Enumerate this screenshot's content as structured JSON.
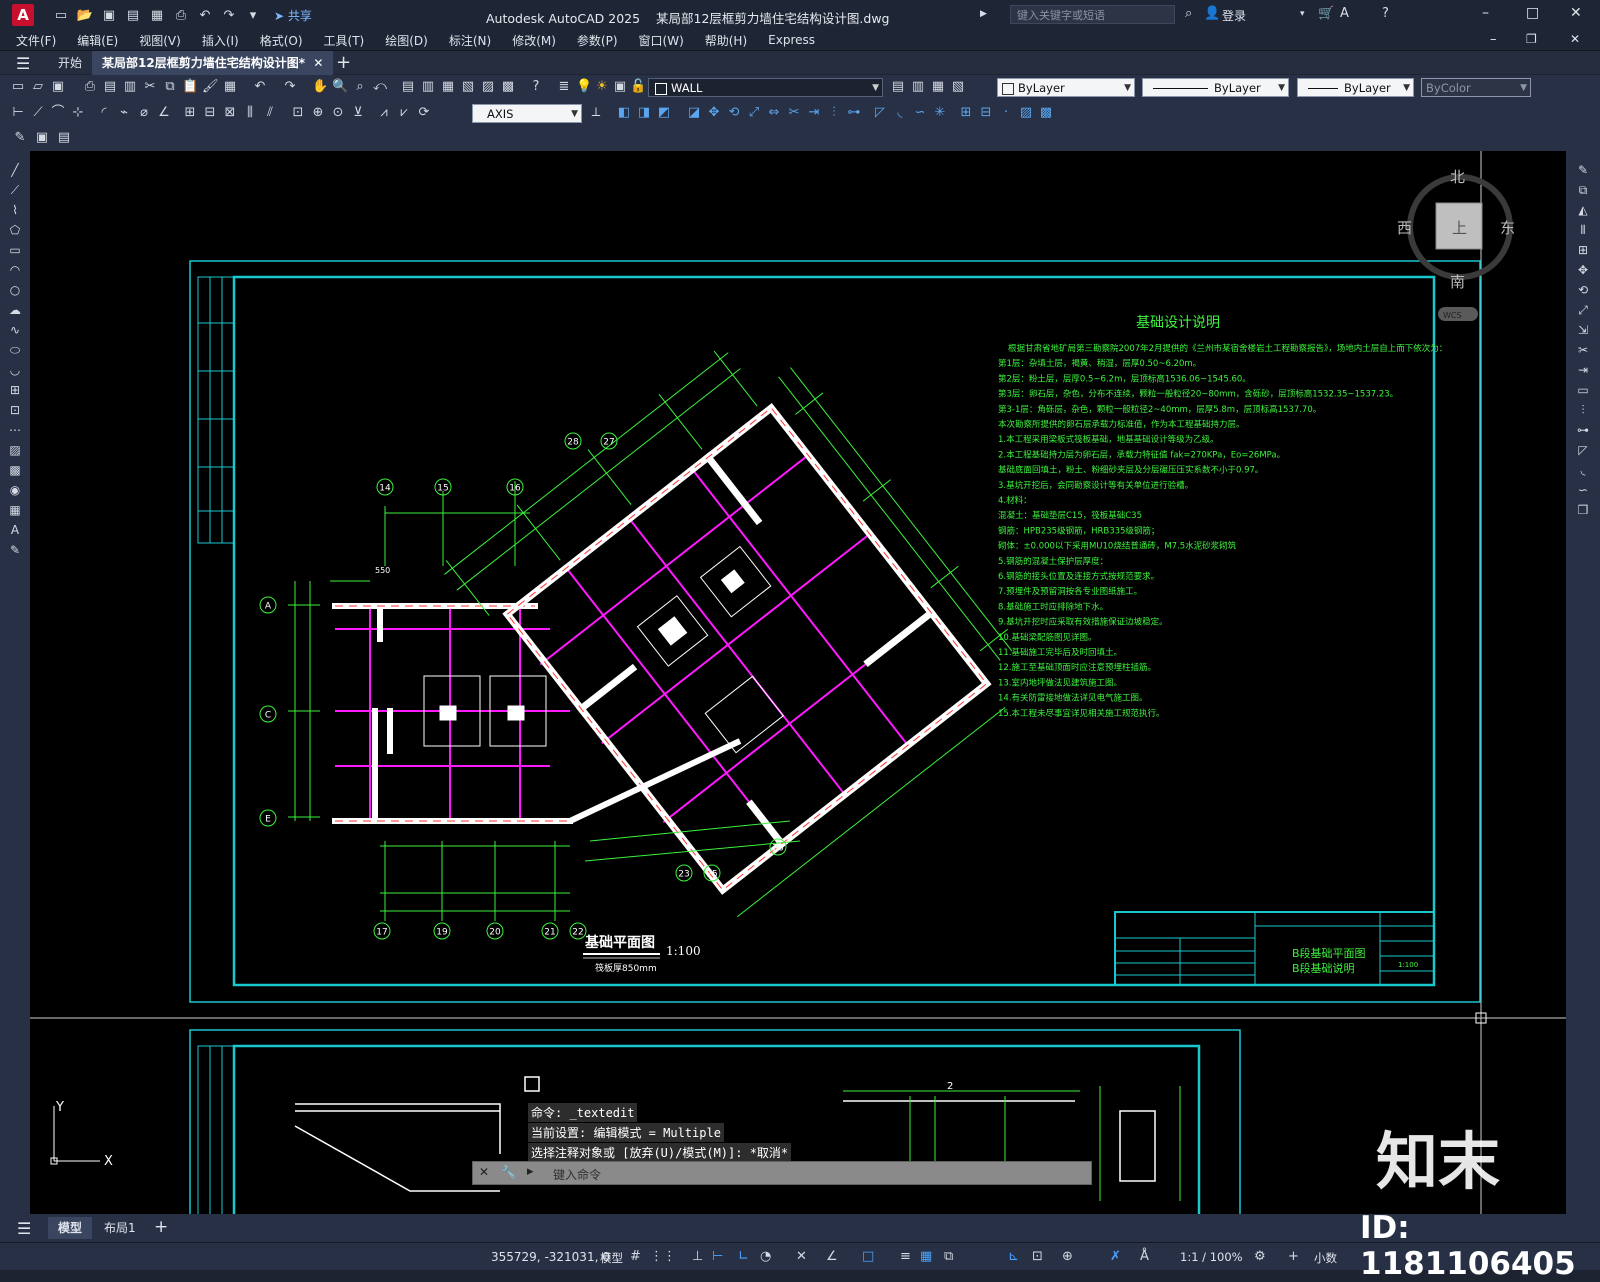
{
  "window": {
    "app_title": "Autodesk AutoCAD 2025",
    "file_name": "某局部12层框剪力墙住宅结构设计图.dwg",
    "share_label": "共享",
    "search_placeholder": "键入关键字或短语",
    "login_label": "登录"
  },
  "menu": [
    "文件(F)",
    "编辑(E)",
    "视图(V)",
    "插入(I)",
    "格式(O)",
    "工具(T)",
    "绘图(D)",
    "标注(N)",
    "修改(M)",
    "参数(P)",
    "窗口(W)",
    "帮助(H)",
    "Express"
  ],
  "tabs": {
    "start": "开始",
    "document": "某局部12层框剪力墙住宅结构设计图*"
  },
  "toolbar": {
    "layer_name": "WALL",
    "color": "ByLayer",
    "linetype": "ByLayer",
    "lineweight": "ByLayer",
    "plotstyle": "ByColor",
    "dimstyle": "AXIS"
  },
  "viewcube": {
    "north": "北",
    "south": "南",
    "east": "东",
    "west": "西",
    "top": "上",
    "wcs": "WCS"
  },
  "drawing": {
    "notes_title": "基础设计说明",
    "plan_title": "基础平面图",
    "plan_scale": "1:100",
    "plan_subtitle": "筏板厚850mm",
    "title_block_name1": "B段基础平面图",
    "title_block_name2": "B段基础说明",
    "title_block_scale": "1:100",
    "notes": [
      "根据甘肃省地矿局第三勘察院2007年2月提供的《兰州市某宿舍楼岩土工程勘察报告》，场地内土层自上而下依次为：",
      "第1层：杂填土层，褐黄、稍湿，层厚0.50~6.20m。",
      "第2层：粉土层，层厚0.5~6.2m，层顶标高1536.06~1545.60。",
      "第3层：卵石层，杂色，分布不连续，颗粒一般粒径20~80mm，含砾砂，层顶标高1532.35~1537.23。",
      "第3-1层：角砾层，杂色，颗粒一般粒径2~40mm，层厚5.8m，层顶标高1537.70。",
      "本次勘察所提供的卵石层承载力标准值，作为本工程基础持力层。",
      "1.本工程采用梁板式筏板基础，地基基础设计等级为乙级。",
      "2.本工程基础持力层为卵石层，承载力特征值 fak=270KPa，Eo=26MPa。",
      "基础底面回填土，粉土、粉细砂夹层及分层碾压压实系数不小于0.97。",
      "3.基坑开挖后，会同勘察设计等有关单位进行验槽。",
      "4.材料：",
      "混凝土：基础垫层C15，筏板基础C35",
      "钢筋：HPB235级钢筋，HRB335级钢筋；",
      "砌体：±0.000以下采用MU10烧结普通砖，M7.5水泥砂浆砌筑",
      "5.钢筋的混凝土保护层厚度：",
      "6.钢筋的接头位置及连接方式按规范要求。",
      "7.预埋件及预留洞按各专业图纸施工。",
      "8.基础施工时应排除地下水。",
      "9.基坑开挖时应采取有效措施保证边坡稳定。",
      "10.基础梁配筋图见详图。",
      "11.基础施工完毕后及时回填土。",
      "12.施工至基础顶面时应注意预埋柱插筋。",
      "13.室内地坪做法见建筑施工图。",
      "14.有关防雷接地做法详见电气施工图。",
      "15.本工程未尽事宜详见相关施工规范执行。"
    ],
    "axis_labels": [
      "14",
      "15",
      "16",
      "17",
      "19",
      "20",
      "21",
      "22",
      "23",
      "25",
      "26",
      "27",
      "28",
      "A",
      "C",
      "E"
    ]
  },
  "command": {
    "line1": "命令: _textedit",
    "line2": "当前设置: 编辑模式 = Multiple",
    "line3": "选择注释对象或 [放弃(U)/模式(M)]: *取消*",
    "prompt": "键入命令"
  },
  "layouts": {
    "model": "模型",
    "layout1": "布局1"
  },
  "status": {
    "coords": "355729, -321031, 0",
    "model": "模型",
    "scale": "1:1 / 100%",
    "units": "小数"
  },
  "watermark": {
    "brand": "知末",
    "id": "ID: 1181106405"
  }
}
